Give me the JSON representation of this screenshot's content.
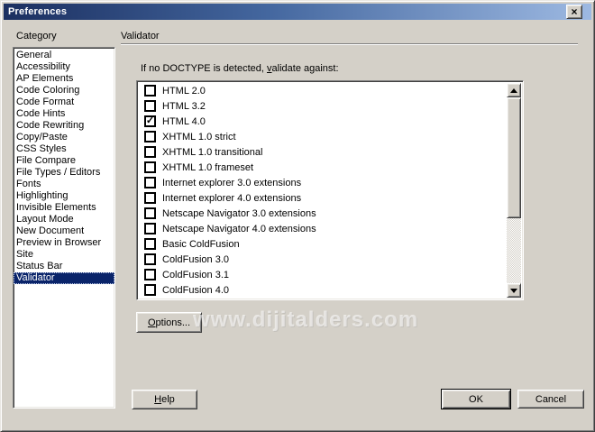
{
  "colors": {
    "face": "#d4d0c8",
    "title-left": "#1b2f60",
    "title-mid": "#44679f",
    "title-right": "#9db9e2",
    "selection": "#0a246a",
    "selection-text": "#ffffff"
  },
  "window": {
    "title": "Preferences",
    "close_glyph": "×"
  },
  "category": {
    "label": "Category",
    "selected": "Validator",
    "items": [
      "General",
      "Accessibility",
      "AP Elements",
      "Code Coloring",
      "Code Format",
      "Code Hints",
      "Code Rewriting",
      "Copy/Paste",
      "CSS Styles",
      "File Compare",
      "File Types / Editors",
      "Fonts",
      "Highlighting",
      "Invisible Elements",
      "Layout Mode",
      "New Document",
      "Preview in Browser",
      "Site",
      "Status Bar",
      "Validator"
    ]
  },
  "validator_panel": {
    "header": "Validator",
    "doctype_label": {
      "pre": "If no DOCTYPE is detected, ",
      "mnemonic": "v",
      "post": "alidate against:"
    },
    "check_glyph": "✓",
    "items": [
      {
        "label": "HTML 2.0",
        "checked": false
      },
      {
        "label": "HTML 3.2",
        "checked": false
      },
      {
        "label": "HTML 4.0",
        "checked": true
      },
      {
        "label": "XHTML 1.0 strict",
        "checked": false
      },
      {
        "label": "XHTML 1.0 transitional",
        "checked": false
      },
      {
        "label": "XHTML 1.0 frameset",
        "checked": false
      },
      {
        "label": "Internet explorer 3.0 extensions",
        "checked": false
      },
      {
        "label": "Internet explorer 4.0 extensions",
        "checked": false
      },
      {
        "label": "Netscape Navigator 3.0 extensions",
        "checked": false
      },
      {
        "label": "Netscape Navigator 4.0 extensions",
        "checked": false
      },
      {
        "label": "Basic ColdFusion",
        "checked": false
      },
      {
        "label": "ColdFusion 3.0",
        "checked": false
      },
      {
        "label": "ColdFusion 3.1",
        "checked": false
      },
      {
        "label": "ColdFusion 4.0",
        "checked": false
      },
      {
        "label": "",
        "checked": false,
        "partial": true
      }
    ],
    "options_button": {
      "mnemonic": "O",
      "post": "ptions..."
    }
  },
  "watermark": "www.dijitalders.com",
  "footer": {
    "help_button": {
      "mnemonic": "H",
      "post": "elp"
    },
    "ok_button": "OK",
    "cancel_button": "Cancel"
  }
}
